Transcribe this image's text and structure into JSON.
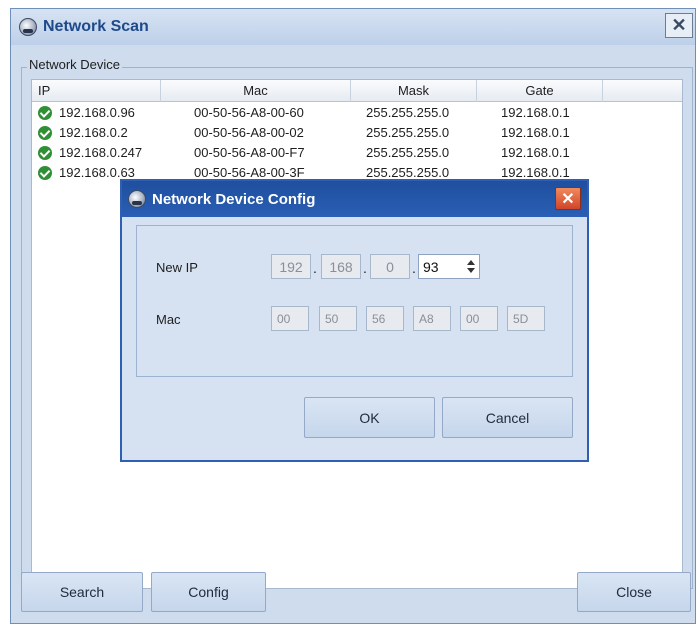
{
  "main_window": {
    "title": "Network Scan",
    "close_label": "✕",
    "group_label": "Network Device",
    "columns": [
      "IP",
      "Mac",
      "Mask",
      "Gate"
    ],
    "rows": [
      {
        "ip": "192.168.0.96",
        "mac": "00-50-56-A8-00-60",
        "mask": "255.255.255.0",
        "gate": "192.168.0.1"
      },
      {
        "ip": "192.168.0.2",
        "mac": "00-50-56-A8-00-02",
        "mask": "255.255.255.0",
        "gate": "192.168.0.1"
      },
      {
        "ip": "192.168.0.247",
        "mac": "00-50-56-A8-00-F7",
        "mask": "255.255.255.0",
        "gate": "192.168.0.1"
      },
      {
        "ip": "192.168.0.63",
        "mac": "00-50-56-A8-00-3F",
        "mask": "255.255.255.0",
        "gate": "192.168.0.1"
      }
    ],
    "buttons": {
      "search": "Search",
      "config": "Config",
      "close": "Close"
    }
  },
  "dialog": {
    "title": "Network Device Config",
    "close_label": "✕",
    "new_ip_label": "New IP",
    "ip_octets": [
      "192",
      "168",
      "0",
      "93"
    ],
    "ip_separator": ".",
    "mac_label": "Mac",
    "mac_octets": [
      "00",
      "50",
      "56",
      "A8",
      "00",
      "5D"
    ],
    "ok_label": "OK",
    "cancel_label": "Cancel"
  },
  "colors": {
    "dialog_titlebar": "#2a5fb5",
    "window_bg": "#cfdcee",
    "status_ok": "#2f8f35"
  },
  "icons": [
    "app-icon",
    "check-icon",
    "close-icon",
    "spin-up-icon",
    "spin-down-icon"
  ]
}
